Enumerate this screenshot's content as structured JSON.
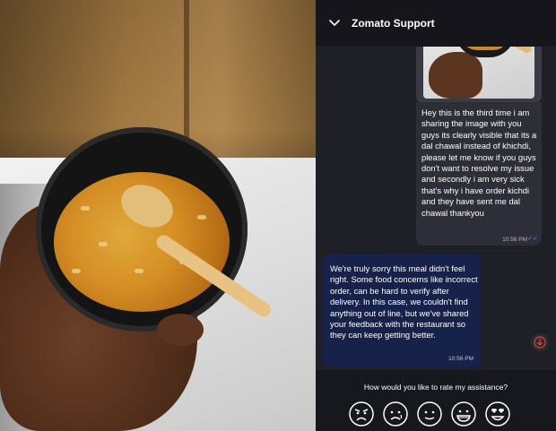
{
  "header": {
    "title": "Zomato Support"
  },
  "messages": {
    "outgoing": {
      "text": "Hey this is the third time i am sharing the image with you guys its clearly visible that its a dal chawal instead of khichdi, please let me know if you guys don't want to resolve my issue and secondly i am very sick that's why i have order kichdi and they have sent me dal chawal thankyou",
      "time": "10:56 PM"
    },
    "incoming": {
      "text": "We're truly sorry this meal didn't feel right. Some food concerns like incorrect order, can be hard to verify after delivery. In this case, we couldn't find anything out of line, but we've shared your feedback with the restaurant so they can keep getting better.",
      "time": "10:56 PM"
    }
  },
  "rating": {
    "question": "How would you like to rate my assistance?",
    "faces": [
      "angry-face-icon",
      "sad-face-icon",
      "neutral-face-icon",
      "happy-face-icon",
      "heart-eyes-face-icon"
    ]
  },
  "colors": {
    "chat_bg": "#1f1f27",
    "incoming_bubble": "#17224a",
    "outgoing_bubble": "#2e2e38",
    "accent_red": "#e0453a",
    "tick_blue": "#4fa3f7"
  }
}
